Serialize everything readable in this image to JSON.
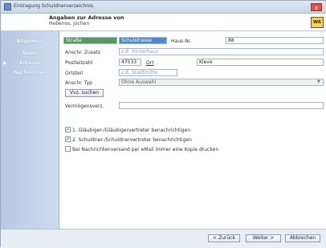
{
  "window": {
    "title": "Eintragung Schuldnerverzeichnis",
    "close_label": "x"
  },
  "header": {
    "title": "Angaben zur Adresse von",
    "subtitle": "Hebenos, Jochen",
    "logo_text": "W6"
  },
  "sidebar": {
    "items": [
      {
        "label": "Allgemein"
      },
      {
        "label": "Name"
      },
      {
        "label": "Adresse",
        "active": true
      },
      {
        "label": "Nachrichten"
      }
    ]
  },
  "form": {
    "strasse_label": "Straße",
    "strasse_value": "Schulstrasse",
    "hausnr_label": "Haus-Nr.",
    "hausnr_value": "88",
    "zusatz_label": "Anschr. Zusatz",
    "zusatz_placeholder": "z.B. Hinterhaus",
    "plz_label": "Postleitzahl",
    "plz_value": "47533",
    "ort_label": "Ort",
    "ort_value": "Kleve",
    "ortsteil_label": "Ortsteil",
    "ortsteil_placeholder": "z.B. Stadtmitte",
    "anschr_typ_label": "Anschr. Typ",
    "anschr_typ_value": "Ohne Auswahl",
    "vvz_button": "Vvz. suchen",
    "vermoegen_label": "Vermögensverz.",
    "vermoegen_value": ""
  },
  "checkboxes": [
    {
      "label": "1. Gläubiger-/Gläubigervertreter benachrichtigen",
      "checked": true,
      "mark": "✓"
    },
    {
      "label": "2. Schuldner-/Schuldnervertreter benachrichtigen",
      "checked": true,
      "mark": "✓"
    },
    {
      "label": "Bei Nachrichtenversand per eMail immer eine Kopie drucken",
      "checked": false,
      "mark": ""
    }
  ],
  "footer": {
    "back_label": "< Zurück",
    "next_label": "Weiter >",
    "cancel_label": "Abbrechen"
  },
  "colors": {
    "accent": "#4a8ad0",
    "highlight_green": "#5a9a58"
  }
}
